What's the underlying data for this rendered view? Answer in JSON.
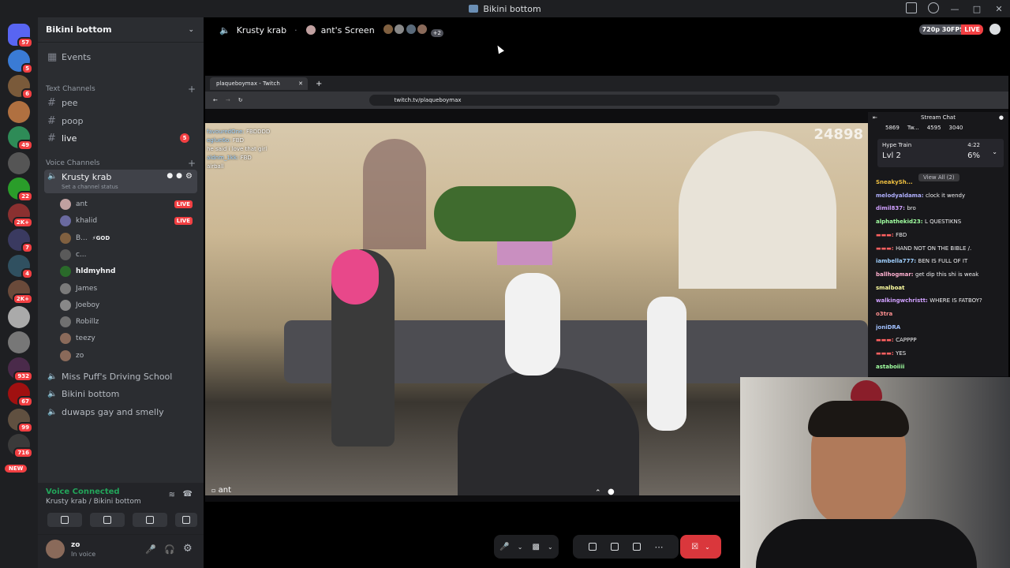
{
  "window": {
    "title": "Bikini bottom"
  },
  "servers": [
    {
      "badge": "57",
      "color": "#5865f2"
    },
    {
      "badge": "5",
      "color": "#3a7bd5"
    },
    {
      "badge": "6",
      "color": "#7a5a3a"
    },
    {
      "badge": "",
      "color": "#b07040"
    },
    {
      "badge": "49",
      "color": "#2e8b57"
    },
    {
      "badge": "",
      "color": "#555"
    },
    {
      "badge": "22",
      "color": "#2a9d2a"
    },
    {
      "badge": "2K+",
      "color": "#8a3030"
    },
    {
      "badge": "7",
      "color": "#3a3a60"
    },
    {
      "badge": "4",
      "color": "#305060"
    },
    {
      "badge": "2K+",
      "color": "#6a4a3a"
    },
    {
      "badge": "",
      "color": "#aaa"
    },
    {
      "badge": "",
      "color": "#777"
    },
    {
      "badge": "932",
      "color": "#4a2a4a"
    },
    {
      "badge": "67",
      "color": "#a01010"
    },
    {
      "badge": "99",
      "color": "#605040"
    },
    {
      "badge": "716",
      "color": "#3a3a3a"
    }
  ],
  "new_badge": "NEW",
  "guild": {
    "name": "Bikini bottom",
    "events": "Events",
    "text_category": "Text Channels",
    "text_channels": [
      {
        "name": "pee",
        "badge": ""
      },
      {
        "name": "poop",
        "badge": ""
      },
      {
        "name": "live",
        "badge": "5"
      }
    ],
    "voice_category": "Voice Channels",
    "active_voice": {
      "name": "Krusty krab",
      "status": "Set a channel status"
    },
    "voice_users": [
      {
        "name": "ant",
        "live": "LIVE",
        "color": "#c0a0a0"
      },
      {
        "name": "khalid",
        "live": "LIVE",
        "color": "#6a6aa0"
      },
      {
        "name": "B...",
        "tag": "GOD",
        "live": "",
        "color": "#806040"
      },
      {
        "name": "c...",
        "live": "",
        "color": "#5a5a5a"
      },
      {
        "name": "hldmyhnd",
        "live": "",
        "color": "#2a6a2a"
      },
      {
        "name": "James",
        "live": "",
        "color": "#7a7a7a"
      },
      {
        "name": "Joeboy",
        "live": "",
        "color": "#888"
      },
      {
        "name": "Robillz",
        "live": "",
        "color": "#707070"
      },
      {
        "name": "teezy",
        "live": "",
        "color": "#8a6a5a"
      },
      {
        "name": "zo",
        "live": "",
        "color": "#8a6a5a"
      }
    ],
    "other_voice": [
      "Miss Puff's Driving School",
      "Bikini bottom",
      "duwaps gay and smelly"
    ]
  },
  "voice_panel": {
    "status": "Voice Connected",
    "location": "Krusty krab / Bikini bottom"
  },
  "user_panel": {
    "name": "zo",
    "status": "In voice"
  },
  "header": {
    "channel": "Krusty krab",
    "screen": "ant's Screen",
    "extra_viewers": "+2",
    "quality": "720p 30FPS",
    "live": "LIVE"
  },
  "browser": {
    "tab_title": "plaqueboymax - Twitch",
    "url": "twitch.tv/plaqueboymax",
    "viewer_count": "24898"
  },
  "overlay_chat": [
    {
      "user": "favouredOne",
      "msg": "FBDDDD"
    },
    {
      "user": "eglue6o",
      "msg": "FBD"
    },
    {
      "user": "",
      "msg": "he said i love that girl"
    },
    {
      "user": "aldnm_1kk",
      "msg": "FBD"
    },
    {
      "user": "",
      "msg": "airball"
    }
  ],
  "stream_chat": {
    "title": "Stream Chat",
    "stats": [
      "5869",
      "Tw...",
      "4595",
      "3040"
    ],
    "hype_train": {
      "label": "Hype Train",
      "level": "Lvl 2",
      "time": "4:22",
      "percent": "6%"
    },
    "view_all": "View All (2)",
    "messages": [
      {
        "user": "SneakySh...",
        "msg": "",
        "color": "#f0c040"
      },
      {
        "user": "melodyaldama",
        "msg": "clock it wendy",
        "color": "#b0b0ff"
      },
      {
        "user": "dimil837",
        "msg": "bro",
        "color": "#d0a0ff"
      },
      {
        "user": "alphathekid23",
        "msg": "L QUESTIKNS",
        "color": "#a0ffa0"
      },
      {
        "user": "",
        "msg": "FBD",
        "color": "#ff6060"
      },
      {
        "user": "",
        "msg": "HAND NOT ON THE BIBLE /.",
        "color": "#ff6060"
      },
      {
        "user": "iambella777",
        "msg": "BEN IS FULL OF IT",
        "color": "#a0d0ff"
      },
      {
        "user": "ballhogmar",
        "msg": "get dip this shi is weak",
        "color": "#ffb0d0"
      },
      {
        "user": "smalboat",
        "msg": "",
        "color": "#ffffa0"
      },
      {
        "user": "walkingwchristt",
        "msg": "WHERE IS FATBOY?",
        "color": "#d0a0ff"
      },
      {
        "user": "o3tra",
        "msg": "",
        "color": "#ff9090"
      },
      {
        "user": "joniDRA",
        "msg": "",
        "color": "#a0c0ff"
      },
      {
        "user": "",
        "msg": "CAPPPP",
        "color": "#ff6060"
      },
      {
        "user": "",
        "msg": "YES",
        "color": "#ff6060"
      },
      {
        "user": "astaboiiii",
        "msg": "",
        "color": "#a0ffa0"
      }
    ]
  },
  "stream_label": "ant"
}
